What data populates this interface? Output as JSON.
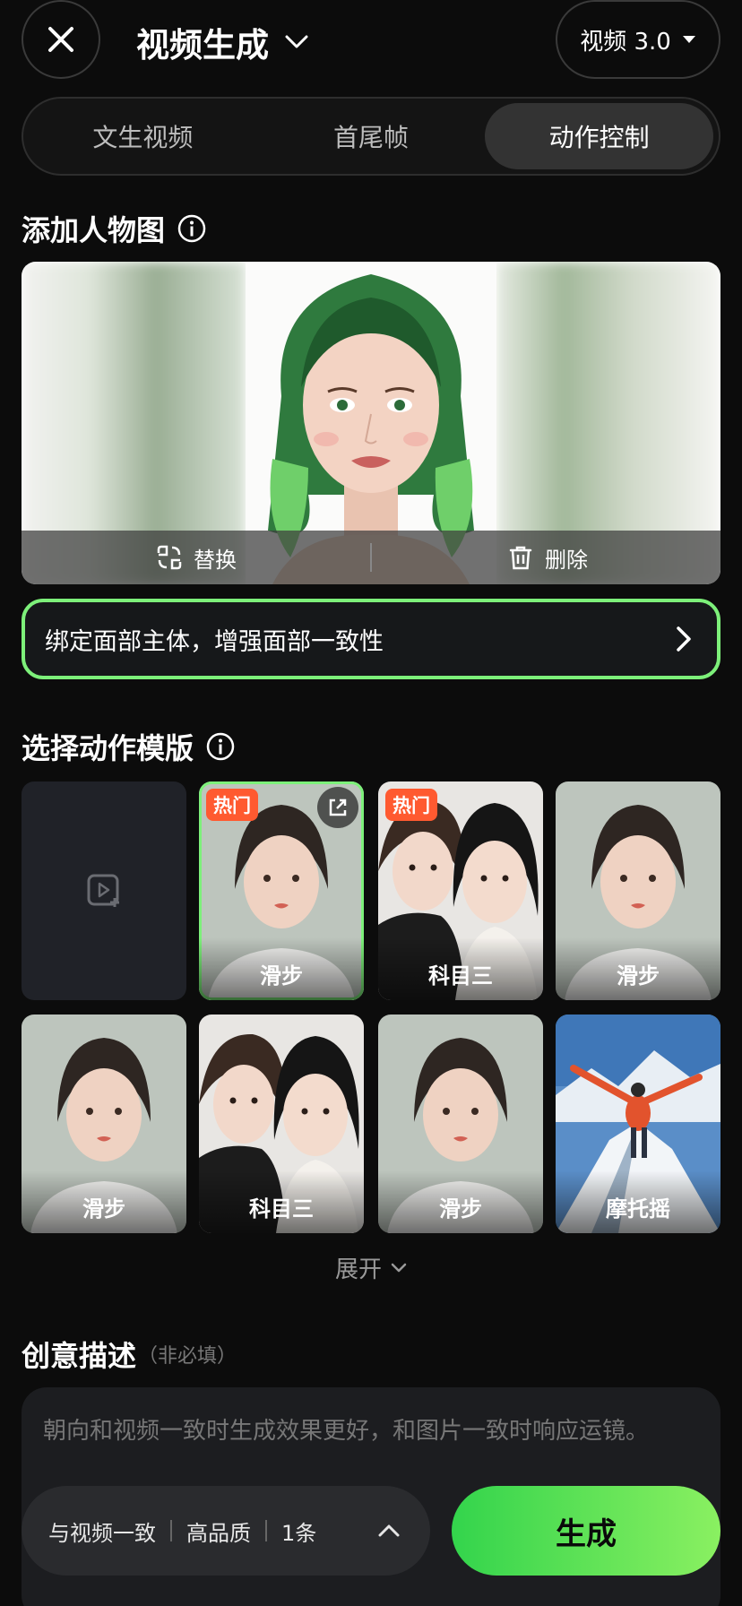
{
  "header": {
    "title": "视频生成",
    "model": "视频 3.0"
  },
  "tabs": [
    {
      "label": "文生视频",
      "active": false
    },
    {
      "label": "首尾帧",
      "active": false
    },
    {
      "label": "动作控制",
      "active": true
    }
  ],
  "person": {
    "section_title": "添加人物图",
    "replace_label": "替换",
    "delete_label": "删除"
  },
  "bind_banner": {
    "text": "绑定面部主体，增强面部一致性"
  },
  "templates": {
    "section_title": "选择动作模版",
    "items": [
      {
        "label": "",
        "type": "upload"
      },
      {
        "label": "滑步",
        "hot": "热门",
        "selected": true
      },
      {
        "label": "科目三",
        "hot": "热门"
      },
      {
        "label": "滑步"
      },
      {
        "label": "滑步"
      },
      {
        "label": "科目三"
      },
      {
        "label": "滑步"
      },
      {
        "label": "摩托摇"
      }
    ],
    "expand_label": "展开"
  },
  "description": {
    "title": "创意描述",
    "optional": "（非必填）",
    "placeholder": "朝向和视频一致时生成效果更好，和图片一致时响应运镜。"
  },
  "settings": {
    "option1": "与视频一致",
    "option2": "高品质",
    "option3": "1条"
  },
  "generate_label": "生成",
  "colors": {
    "accent": "#7df07a",
    "hot_badge": "#ff5a30",
    "generate_gradient_start": "#33d44c",
    "generate_gradient_end": "#8af061"
  }
}
